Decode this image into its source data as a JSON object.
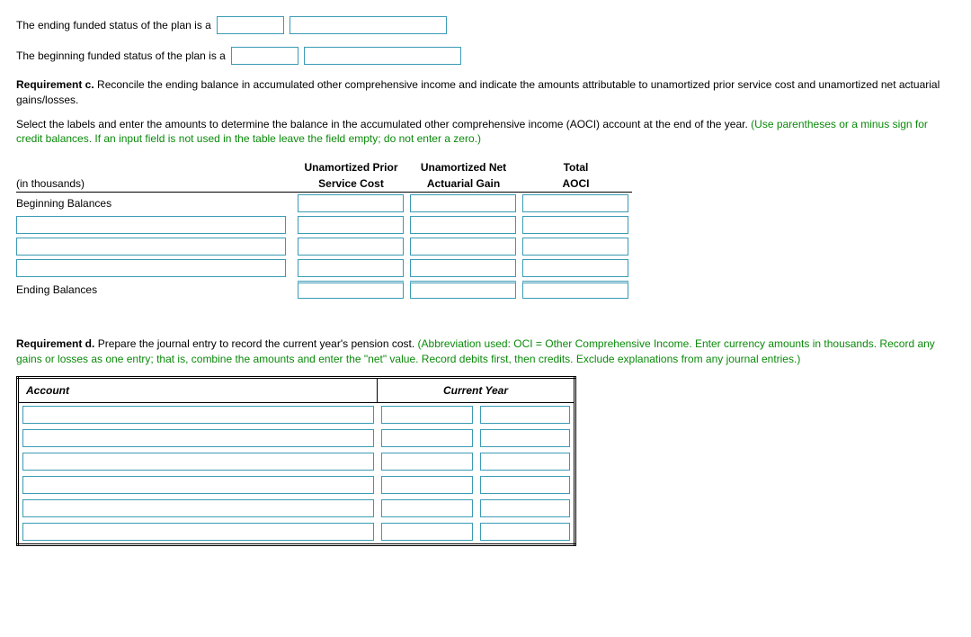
{
  "statements": {
    "ending_text": "The ending funded status of the plan is a",
    "beginning_text": "The beginning funded status of the plan is a"
  },
  "req_c": {
    "label_bold": "Requirement c.",
    "label_text": " Reconcile the ending balance in accumulated other comprehensive income and indicate the amounts attributable to unamortized prior service cost and unamortized net actuarial gains/losses.",
    "instruction_text": "Select the labels and enter the amounts to determine the balance in the accumulated other comprehensive income (AOCI) account at the end of the year. ",
    "instruction_green": "(Use parentheses or a minus sign for credit balances. If an input field is not used in the table leave the field empty; do not enter a zero.)"
  },
  "aoci_headers": {
    "in_thousands": "(in thousands)",
    "col1_line1": "Unamortized Prior",
    "col1_line2": "Service Cost",
    "col2_line1": "Unamortized Net",
    "col2_line2": "Actuarial Gain",
    "col3_line1": "Total",
    "col3_line2": "AOCI"
  },
  "aoci_rows": {
    "beginning": "Beginning Balances",
    "ending": "Ending Balances"
  },
  "req_d": {
    "label_bold": "Requirement d.",
    "label_text": " Prepare the journal entry to record the current year's pension cost. ",
    "instruction_green": "(Abbreviation used: OCI = Other Comprehensive  Income. Enter currency amounts in thousands. Record any gains or losses as one entry; that is, combine the amounts and enter the \"net\" value. Record debits first, then credits. Exclude explanations from any journal entries.)"
  },
  "journal_headers": {
    "account": "Account",
    "current_year": "Current Year"
  }
}
